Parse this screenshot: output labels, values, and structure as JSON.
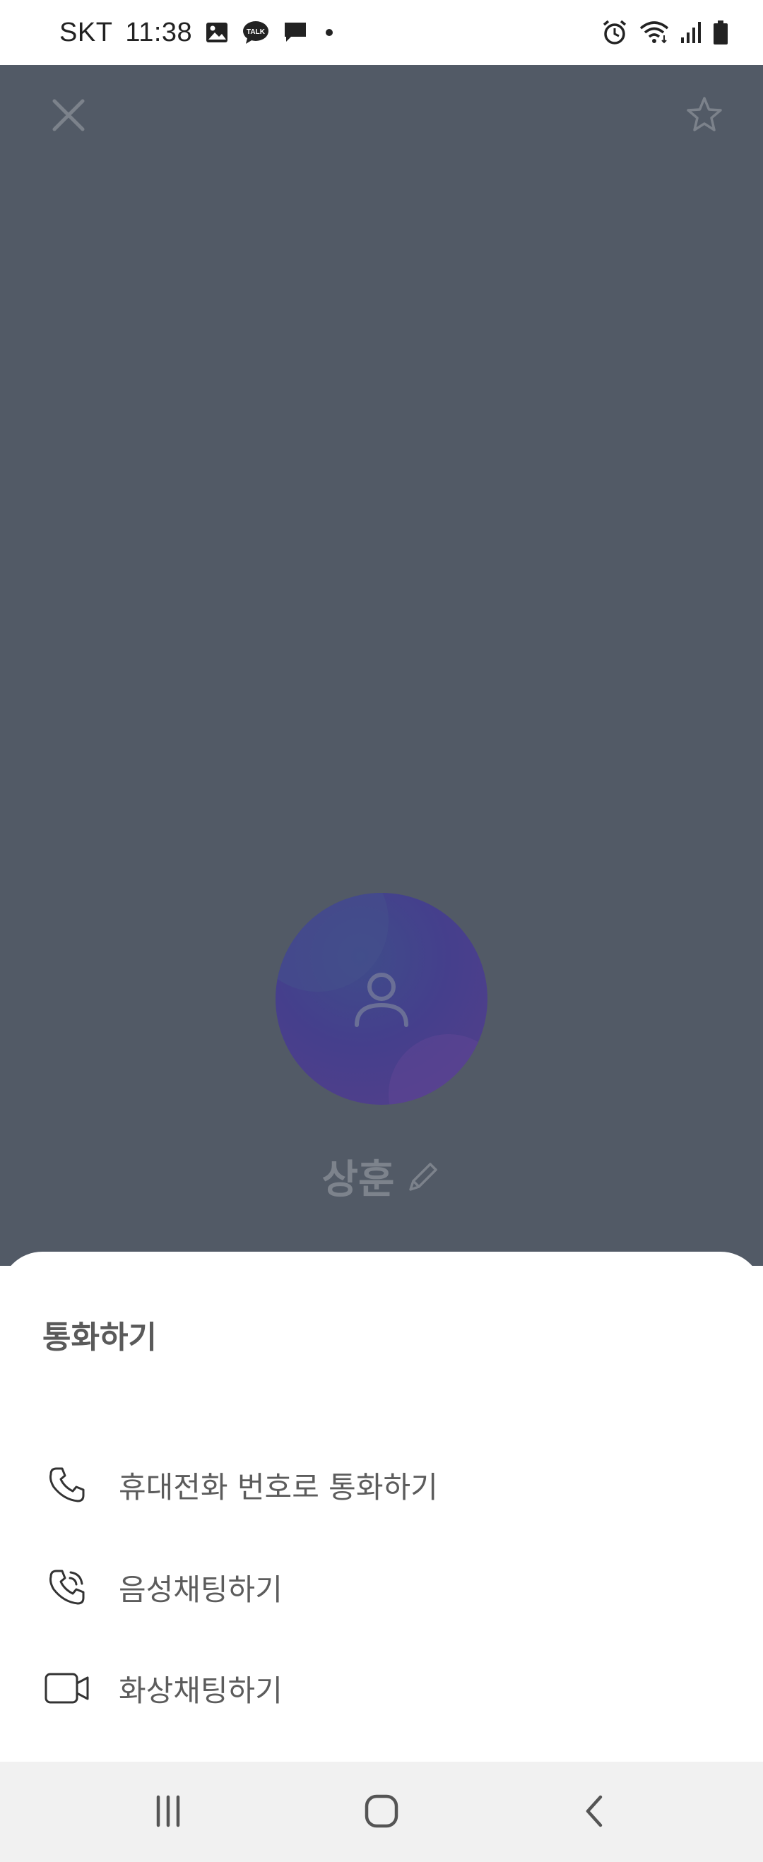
{
  "status_bar": {
    "carrier": "SKT",
    "time": "11:38",
    "left_icons": [
      "gallery-icon",
      "kakaotalk-icon",
      "message-icon",
      "dot-icon"
    ],
    "right_icons": [
      "alarm-icon",
      "wifi-icon",
      "signal-icon",
      "battery-icon"
    ],
    "kakaotalk_badge_text": "TALK"
  },
  "profile": {
    "background_color": "#525a66",
    "name": "상훈",
    "close_icon": "close-icon",
    "favorite_icon": "star-icon",
    "edit_icon": "pencil-icon",
    "avatar_icon": "person-icon"
  },
  "call_sheet": {
    "title": "통화하기",
    "options": [
      {
        "label": "휴대전화 번호로 통화하기",
        "icon": "phone-icon"
      },
      {
        "label": "음성채팅하기",
        "icon": "voice-call-icon"
      },
      {
        "label": "화상채팅하기",
        "icon": "video-camera-icon"
      }
    ]
  },
  "nav_bar": {
    "items": [
      "recent-apps-icon",
      "home-icon",
      "back-icon"
    ]
  }
}
